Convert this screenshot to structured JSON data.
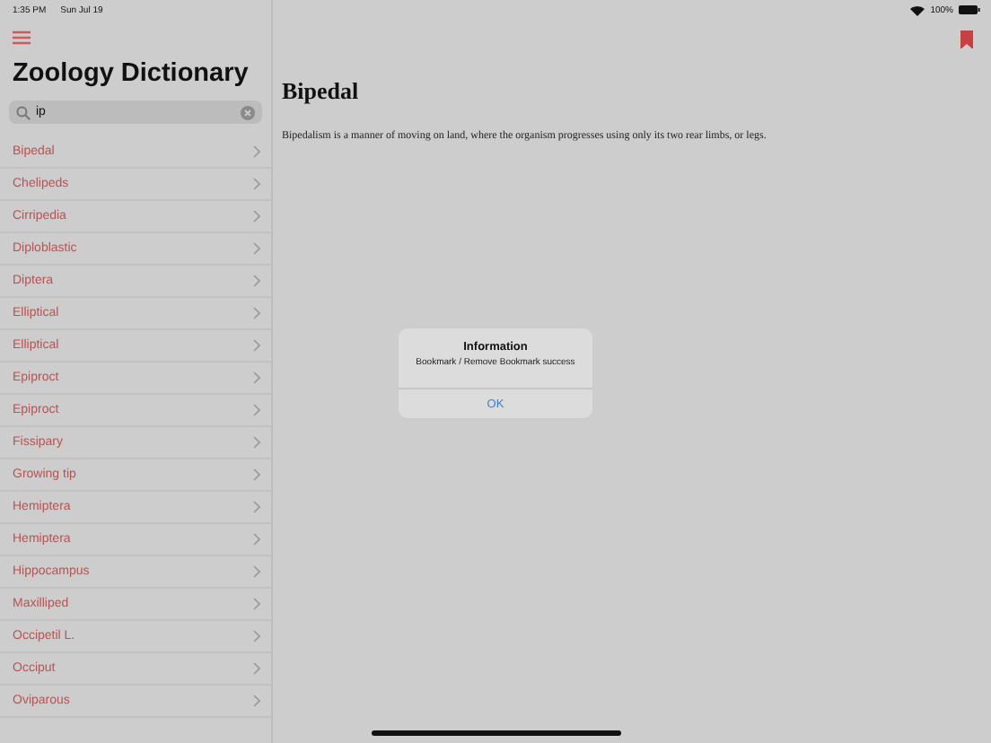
{
  "status_bar": {
    "time": "1:35 PM",
    "date": "Sun Jul 19",
    "battery": "100%"
  },
  "sidebar": {
    "title": "Zoology Dictionary",
    "search": {
      "value": "ip"
    },
    "items": [
      {
        "label": "Bipedal"
      },
      {
        "label": "Chelipeds"
      },
      {
        "label": "Cirripedia"
      },
      {
        "label": "Diploblastic"
      },
      {
        "label": "Diptera"
      },
      {
        "label": "Elliptical"
      },
      {
        "label": "Elliptical"
      },
      {
        "label": "Epiproct"
      },
      {
        "label": "Epiproct"
      },
      {
        "label": "Fissipary"
      },
      {
        "label": "Growing tip"
      },
      {
        "label": "Hemiptera"
      },
      {
        "label": "Hemiptera"
      },
      {
        "label": "Hippocampus"
      },
      {
        "label": "Maxilliped"
      },
      {
        "label": "Occipetil L."
      },
      {
        "label": "Occiput"
      },
      {
        "label": "Oviparous"
      }
    ]
  },
  "detail": {
    "term": "Bipedal",
    "bookmarked": true,
    "definition": "Bipedalism is a manner of moving on land, where the organism progresses using only its two rear limbs, or legs."
  },
  "alert": {
    "title": "Information",
    "message": "Bookmark / Remove Bookmark success",
    "button": "OK"
  }
}
